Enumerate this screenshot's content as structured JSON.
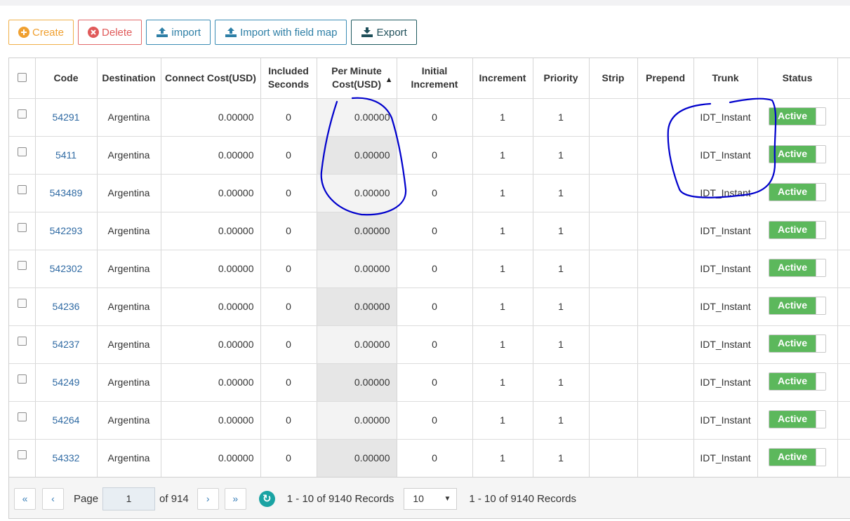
{
  "toolbar": {
    "create_label": "Create",
    "delete_label": "Delete",
    "import_label": "import",
    "import_map_label": "Import with field map",
    "export_label": "Export"
  },
  "table": {
    "headers": {
      "code": "Code",
      "destination": "Destination",
      "connect_cost": "Connect Cost(USD)",
      "included_seconds": "Included Seconds",
      "per_minute_cost": "Per Minute Cost(USD)",
      "initial_increment": "Initial Increment",
      "increment": "Increment",
      "priority": "Priority",
      "strip": "Strip",
      "prepend": "Prepend",
      "trunk": "Trunk",
      "status": "Status"
    },
    "rows": [
      {
        "code": "54291",
        "destination": "Argentina",
        "connect_cost": "0.00000",
        "included_seconds": "0",
        "per_minute_cost": "0.00000",
        "initial_increment": "0",
        "increment": "1",
        "priority": "1",
        "strip": "",
        "prepend": "",
        "trunk": "IDT_Instant",
        "status": "Active"
      },
      {
        "code": "5411",
        "destination": "Argentina",
        "connect_cost": "0.00000",
        "included_seconds": "0",
        "per_minute_cost": "0.00000",
        "initial_increment": "0",
        "increment": "1",
        "priority": "1",
        "strip": "",
        "prepend": "",
        "trunk": "IDT_Instant",
        "status": "Active"
      },
      {
        "code": "543489",
        "destination": "Argentina",
        "connect_cost": "0.00000",
        "included_seconds": "0",
        "per_minute_cost": "0.00000",
        "initial_increment": "0",
        "increment": "1",
        "priority": "1",
        "strip": "",
        "prepend": "",
        "trunk": "IDT_Instant",
        "status": "Active"
      },
      {
        "code": "542293",
        "destination": "Argentina",
        "connect_cost": "0.00000",
        "included_seconds": "0",
        "per_minute_cost": "0.00000",
        "initial_increment": "0",
        "increment": "1",
        "priority": "1",
        "strip": "",
        "prepend": "",
        "trunk": "IDT_Instant",
        "status": "Active"
      },
      {
        "code": "542302",
        "destination": "Argentina",
        "connect_cost": "0.00000",
        "included_seconds": "0",
        "per_minute_cost": "0.00000",
        "initial_increment": "0",
        "increment": "1",
        "priority": "1",
        "strip": "",
        "prepend": "",
        "trunk": "IDT_Instant",
        "status": "Active"
      },
      {
        "code": "54236",
        "destination": "Argentina",
        "connect_cost": "0.00000",
        "included_seconds": "0",
        "per_minute_cost": "0.00000",
        "initial_increment": "0",
        "increment": "1",
        "priority": "1",
        "strip": "",
        "prepend": "",
        "trunk": "IDT_Instant",
        "status": "Active"
      },
      {
        "code": "54237",
        "destination": "Argentina",
        "connect_cost": "0.00000",
        "included_seconds": "0",
        "per_minute_cost": "0.00000",
        "initial_increment": "0",
        "increment": "1",
        "priority": "1",
        "strip": "",
        "prepend": "",
        "trunk": "IDT_Instant",
        "status": "Active"
      },
      {
        "code": "54249",
        "destination": "Argentina",
        "connect_cost": "0.00000",
        "included_seconds": "0",
        "per_minute_cost": "0.00000",
        "initial_increment": "0",
        "increment": "1",
        "priority": "1",
        "strip": "",
        "prepend": "",
        "trunk": "IDT_Instant",
        "status": "Active"
      },
      {
        "code": "54264",
        "destination": "Argentina",
        "connect_cost": "0.00000",
        "included_seconds": "0",
        "per_minute_cost": "0.00000",
        "initial_increment": "0",
        "increment": "1",
        "priority": "1",
        "strip": "",
        "prepend": "",
        "trunk": "IDT_Instant",
        "status": "Active"
      },
      {
        "code": "54332",
        "destination": "Argentina",
        "connect_cost": "0.00000",
        "included_seconds": "0",
        "per_minute_cost": "0.00000",
        "initial_increment": "0",
        "increment": "1",
        "priority": "1",
        "strip": "",
        "prepend": "",
        "trunk": "IDT_Instant",
        "status": "Active"
      }
    ]
  },
  "pager": {
    "page_label": "Page",
    "page_value": "1",
    "of_label": "of 914",
    "records_text": "1 - 10 of 9140 Records",
    "per_page_value": "10",
    "records_text_right": "1 - 10 of 9140 Records"
  },
  "colors": {
    "create": "#f0a030",
    "delete": "#e05a5a",
    "import": "#2e7fa6",
    "export": "#1f4f5a",
    "status_active": "#5cb85c",
    "link": "#2f6aa3",
    "annotation": "#0000cc"
  },
  "icons": {
    "create": "plus-circle-icon",
    "delete": "times-circle-icon",
    "import": "upload-icon",
    "export": "download-icon",
    "sort": "caret-up-icon",
    "refresh": "refresh-icon"
  }
}
